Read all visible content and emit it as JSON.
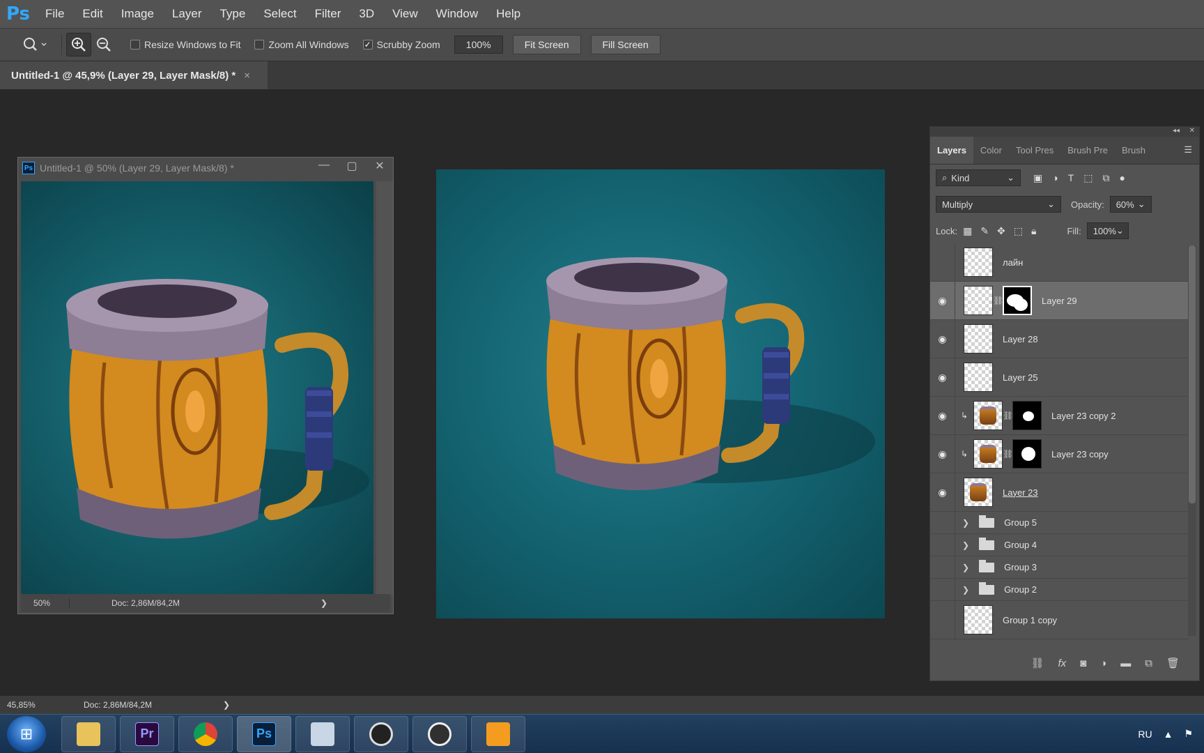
{
  "menubar": {
    "logo": "Ps",
    "items": [
      "File",
      "Edit",
      "Image",
      "Layer",
      "Type",
      "Select",
      "Filter",
      "3D",
      "View",
      "Window",
      "Help"
    ]
  },
  "options": {
    "resize_windows": "Resize Windows to Fit",
    "zoom_all": "Zoom All Windows",
    "scrubby_zoom": "Scrubby Zoom",
    "zoom_value": "100%",
    "fit_screen": "Fit Screen",
    "fill_screen": "Fill Screen"
  },
  "tab": {
    "title": "Untitled-1 @ 45,9% (Layer 29, Layer Mask/8) *",
    "close": "×"
  },
  "float_window": {
    "app_icon": "Ps",
    "title": "Untitled-1 @ 50% (Layer 29, Layer Mask/8) *",
    "zoom": "50%",
    "doc": "Doc: 2,86M/84,2M",
    "arrow": "❯"
  },
  "layers_panel": {
    "tabs": [
      "Layers",
      "Color",
      "Tool Pres",
      "Brush Pre",
      "Brush"
    ],
    "filter_kind": "Kind",
    "blend_mode": "Multiply",
    "opacity_label": "Opacity:",
    "opacity_value": "60%",
    "lock_label": "Lock:",
    "fill_label": "Fill:",
    "fill_value": "100%",
    "layers": [
      {
        "name": "лайн",
        "visible": false
      },
      {
        "name": "Layer 29",
        "visible": true
      },
      {
        "name": "Layer 28",
        "visible": true
      },
      {
        "name": "Layer 25",
        "visible": true
      },
      {
        "name": "Layer 23 copy 2",
        "visible": true
      },
      {
        "name": "Layer 23 copy",
        "visible": true
      },
      {
        "name": "Layer 23",
        "visible": true
      },
      {
        "name": "Group 5",
        "visible": false
      },
      {
        "name": "Group 4",
        "visible": false
      },
      {
        "name": "Group 3",
        "visible": false
      },
      {
        "name": "Group 2",
        "visible": false
      },
      {
        "name": "Group 1 copy",
        "visible": false
      }
    ]
  },
  "statusbar": {
    "zoom": "45,85%",
    "doc": "Doc: 2,86M/84,2M",
    "arrow": "❯"
  },
  "taskbar": {
    "apps": [
      "file-explorer",
      "premiere-pro",
      "chrome",
      "photoshop",
      "calculator",
      "obs-like",
      "obs",
      "media-player"
    ],
    "premiere_label": "Pr",
    "photoshop_label": "Ps",
    "language": "RU"
  },
  "colors": {
    "canvas_teal": "#146472",
    "accent_ps": "#31a8ff",
    "premiere": "#9999ff"
  }
}
